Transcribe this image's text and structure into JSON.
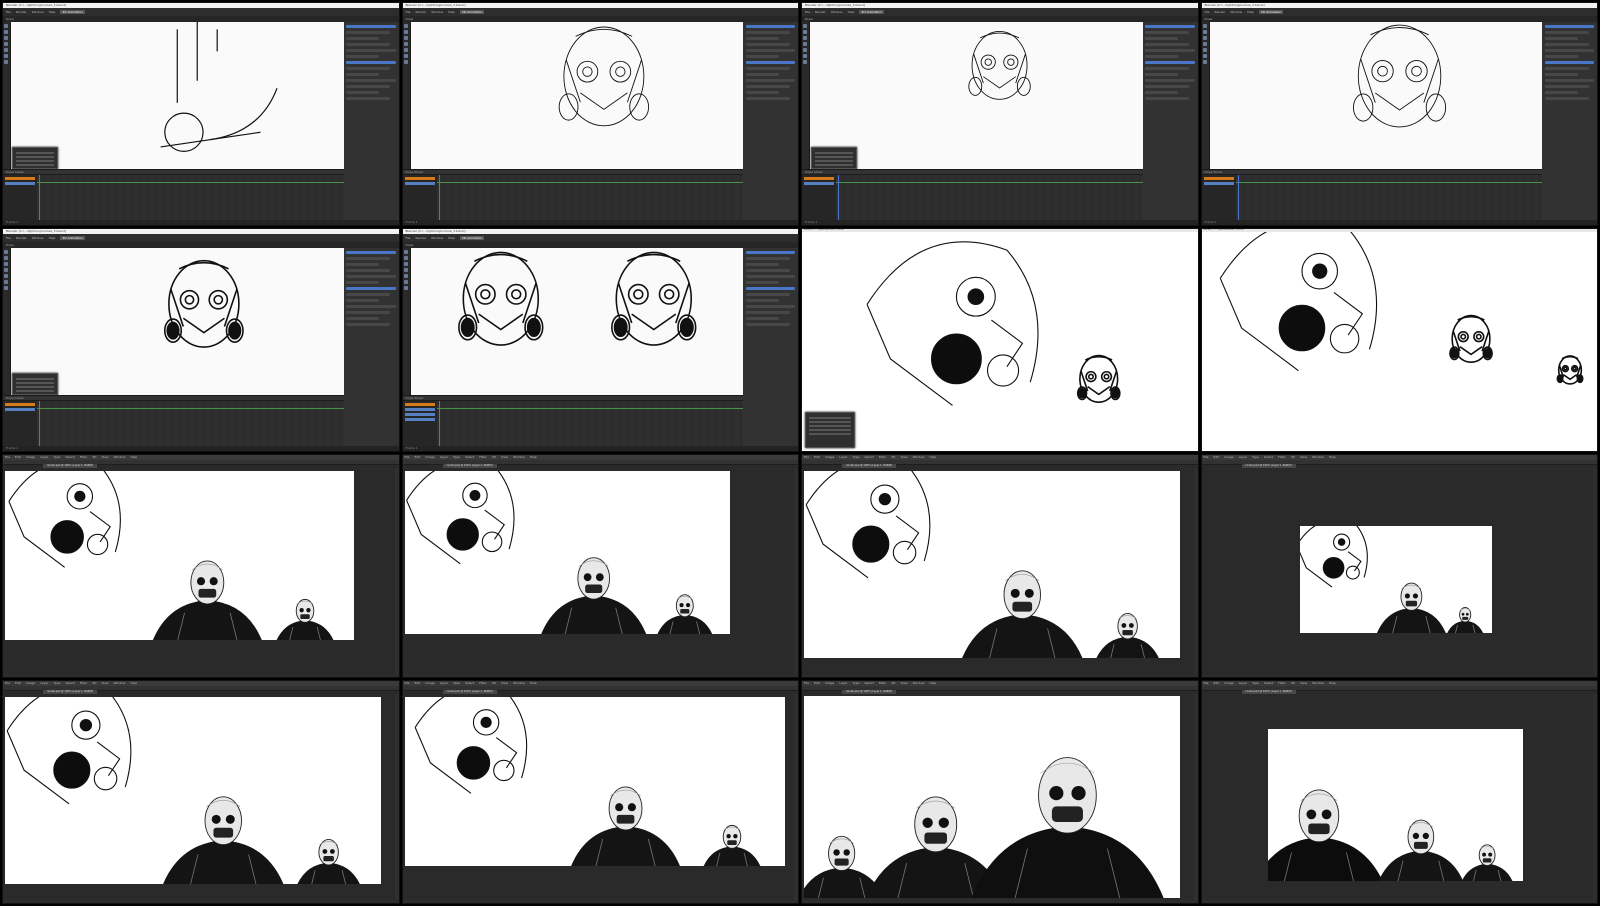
{
  "sheet": {
    "columns": 4,
    "rows": 4,
    "tiles": [
      {
        "id": "t1",
        "kind": "animation-editor",
        "app": "Blender",
        "title": "Blender [C:\\...\\lightningmodule_3.blend]",
        "menus": [
          "File",
          "Render",
          "Window",
          "Help"
        ],
        "workspace": "2D Animation",
        "sketch": "lines",
        "popover": true,
        "active_tab": "Draw",
        "timeline_label": "Dope Sheet",
        "channels": [
          "Layer",
          "Lines"
        ],
        "status": "Frame 1"
      },
      {
        "id": "t2",
        "kind": "animation-editor",
        "app": "Blender",
        "title": "Blender [C:\\...\\lightningmodule_3.blend]",
        "menus": [
          "File",
          "Render",
          "Window",
          "Help"
        ],
        "workspace": "2D Animation",
        "sketch": "mask-sketch",
        "popover": false,
        "active_tab": "Draw",
        "timeline_label": "Dope Sheet",
        "channels": [
          "Layer",
          "Lines"
        ],
        "status": "Frame 1"
      },
      {
        "id": "t3",
        "kind": "animation-editor",
        "app": "Blender",
        "title": "Blender [C:\\...\\lightningmodule_3.blend]",
        "menus": [
          "File",
          "Render",
          "Window",
          "Help"
        ],
        "workspace": "2D Animation",
        "sketch": "mask-small",
        "popover": true,
        "active_tab": "Draw",
        "timeline_label": "Dope Sheet",
        "channels": [
          "Layer",
          "Lines"
        ],
        "status": "Frame 1"
      },
      {
        "id": "t4",
        "kind": "animation-editor",
        "app": "Blender",
        "title": "Blender [C:\\...\\lightningmodule_3.blend]",
        "menus": [
          "File",
          "Render",
          "Window",
          "Help"
        ],
        "workspace": "2D Animation",
        "sketch": "skull-sketch",
        "popover": false,
        "active_tab": "Draw",
        "timeline_label": "Dope Sheet",
        "channels": [
          "Layer",
          "Lines"
        ],
        "status": "Frame 1"
      },
      {
        "id": "t5",
        "kind": "animation-editor",
        "app": "Blender",
        "title": "Blender [C:\\...\\lightningmodule_3.blend]",
        "menus": [
          "File",
          "Render",
          "Window",
          "Help"
        ],
        "workspace": "2D Animation",
        "sketch": "mask-mid",
        "popover": true,
        "active_tab": "Draw",
        "timeline_label": "Dope Sheet",
        "channels": [
          "Layer",
          "Lines"
        ],
        "status": "Frame 1"
      },
      {
        "id": "t6",
        "kind": "animation-editor",
        "app": "Blender",
        "title": "Blender [C:\\...\\lightningmodule_3.blend]",
        "menus": [
          "File",
          "Render",
          "Window",
          "Help"
        ],
        "workspace": "2D Animation",
        "sketch": "mask-pair",
        "popover": false,
        "active_tab": "Draw",
        "timeline_label": "Dope Sheet",
        "channels": [
          "Layer",
          "Lines",
          "Fills",
          "Mask"
        ],
        "status": "Frame 1"
      },
      {
        "id": "t7",
        "kind": "fullscreen",
        "title": "Blender [C:\\...\\lightningmodule_3.blend]",
        "sketch": "mask-big-left",
        "popover": true
      },
      {
        "id": "t8",
        "kind": "fullscreen",
        "title": "Blender [C:\\...\\lightningmodule_3.blend]",
        "sketch": "mask-three",
        "popover": false
      },
      {
        "id": "t9",
        "kind": "paint-editor",
        "app": "Photoshop",
        "menus": [
          "File",
          "Edit",
          "Image",
          "Layer",
          "Type",
          "Select",
          "Filter",
          "3D",
          "View",
          "Window",
          "Help"
        ],
        "doc_tab": "render.psd @ 100% (Layer 1, RGB/8)",
        "scene": "group-wide",
        "canvas_fit": "left-crop"
      },
      {
        "id": "t10",
        "kind": "paint-editor",
        "app": "Photoshop",
        "menus": [
          "File",
          "Edit",
          "Image",
          "Layer",
          "Type",
          "Select",
          "Filter",
          "3D",
          "View",
          "Window",
          "Help"
        ],
        "doc_tab": "render.psd @ 100% (Layer 1, RGB/8)",
        "scene": "group-wide",
        "canvas_fit": "left-mid"
      },
      {
        "id": "t11",
        "kind": "paint-editor",
        "app": "Photoshop",
        "menus": [
          "File",
          "Edit",
          "Image",
          "Layer",
          "Type",
          "Select",
          "Filter",
          "3D",
          "View",
          "Window",
          "Help"
        ],
        "doc_tab": "render.psd @ 100% (Layer 1, RGB/8)",
        "scene": "group-wide",
        "canvas_fit": "wide"
      },
      {
        "id": "t12",
        "kind": "paint-editor",
        "app": "Photoshop",
        "menus": [
          "File",
          "Edit",
          "Image",
          "Layer",
          "Type",
          "Select",
          "Filter",
          "3D",
          "View",
          "Window",
          "Help"
        ],
        "doc_tab": "render.psd @ 100% (Layer 1, RGB/8)",
        "scene": "group-wide",
        "canvas_fit": "centered-small"
      },
      {
        "id": "t13",
        "kind": "paint-editor",
        "app": "Photoshop",
        "menus": [
          "File",
          "Edit",
          "Image",
          "Layer",
          "Type",
          "Select",
          "Filter",
          "3D",
          "View",
          "Window",
          "Help"
        ],
        "doc_tab": "render.psd @ 100% (Layer 1, RGB/8)",
        "scene": "group-wide",
        "canvas_fit": "wide"
      },
      {
        "id": "t14",
        "kind": "paint-editor",
        "app": "Photoshop",
        "menus": [
          "File",
          "Edit",
          "Image",
          "Layer",
          "Type",
          "Select",
          "Filter",
          "3D",
          "View",
          "Window",
          "Help"
        ],
        "doc_tab": "render.psd @ 100% (Layer 1, RGB/8)",
        "scene": "group-wide",
        "canvas_fit": "top"
      },
      {
        "id": "t15",
        "kind": "paint-editor",
        "app": "Photoshop",
        "menus": [
          "File",
          "Edit",
          "Image",
          "Layer",
          "Type",
          "Select",
          "Filter",
          "3D",
          "View",
          "Window",
          "Help"
        ],
        "doc_tab": "render.psd @ 100% (Layer 1, RGB/8)",
        "scene": "group-close",
        "canvas_fit": "full"
      },
      {
        "id": "t16",
        "kind": "paint-editor",
        "app": "Photoshop",
        "menus": [
          "File",
          "Edit",
          "Image",
          "Layer",
          "Type",
          "Select",
          "Filter",
          "3D",
          "View",
          "Window",
          "Help"
        ],
        "doc_tab": "render.psd @ 100% (Layer 1, RGB/8)",
        "scene": "group-close-small",
        "canvas_fit": "centered-mid"
      }
    ]
  },
  "colors": {
    "blender_panel": "#3a3a3a",
    "blender_accent": "#4a76c8",
    "keyframe_orange": "#d67b1c",
    "timeline_green": "#4caf50",
    "photoshop_bg": "#2a2a2a",
    "canvas": "#ffffff"
  }
}
